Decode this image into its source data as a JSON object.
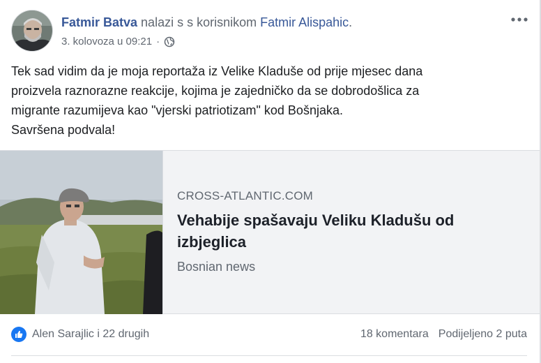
{
  "post": {
    "author": "Fatmir Batva",
    "with_text": " nalazi s s korisnikom ",
    "tagged_user": "Fatmir Alispahic",
    "tagged_suffix": ".",
    "timestamp": "3. kolovoza u 09:21",
    "meta_separator": "·",
    "privacy_icon": "globe-icon",
    "more_icon": "more-options-icon",
    "text_lines": [
      "Tek sad vidim da je moja reportaža iz Velike Kladuše od prije mjesec dana",
      "proizvela raznorazne reakcije, kojima je zajedničko da se dobrodošlica za",
      "migrante razumijeva kao \"vjerski patriotizam\" kod Bošnjaka.",
      "Savršena podvala!"
    ]
  },
  "link_preview": {
    "domain": "CROSS-ATLANTIC.COM",
    "title_line1": "Vehabije spašavaju Veliku Kladušu od",
    "title_line2": "izbjeglica",
    "description": "Bosnian news"
  },
  "footer": {
    "reaction_icon": "like-icon",
    "likes_text": "Alen Sarajlic i 22 drugih",
    "comments_text": "18 komentara",
    "shares_text": "Podijeljeno 2 puta"
  },
  "colors": {
    "link_blue": "#385898",
    "secondary_text": "#606770",
    "like_blue": "#1877f2",
    "card_background": "#f2f3f5"
  }
}
